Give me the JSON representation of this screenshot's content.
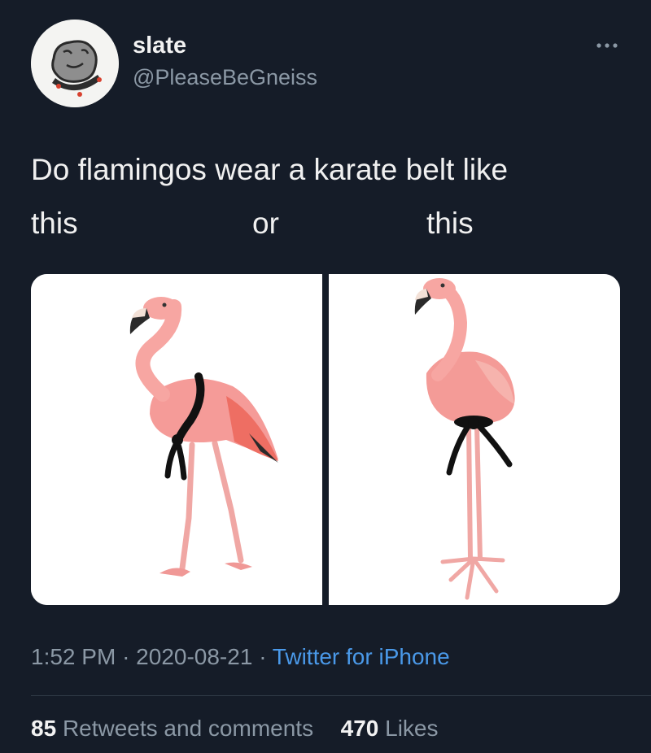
{
  "author": {
    "display_name": "slate",
    "handle": "@PleaseBeGneiss",
    "avatar_icon": "rock-face-avatar-icon"
  },
  "more_icon": "ellipsis-icon",
  "tweet": {
    "line1": "Do flamingos wear a karate belt like",
    "word_this_1": "this",
    "word_or": "or",
    "word_this_2": "this"
  },
  "media": {
    "left_image": "flamingo-belt-over-shoulder-image",
    "right_image": "flamingo-belt-around-legs-image"
  },
  "meta": {
    "time": "1:52 PM",
    "separator": "·",
    "date": "2020-08-21",
    "source": "Twitter for iPhone"
  },
  "stats": {
    "retweets_count": "85",
    "retweets_label": "Retweets and comments",
    "likes_count": "470",
    "likes_label": "Likes"
  },
  "colors": {
    "background": "#151c28",
    "link": "#4a99e9",
    "secondary_text": "#8b98a5",
    "flamingo": "#f29a98"
  }
}
